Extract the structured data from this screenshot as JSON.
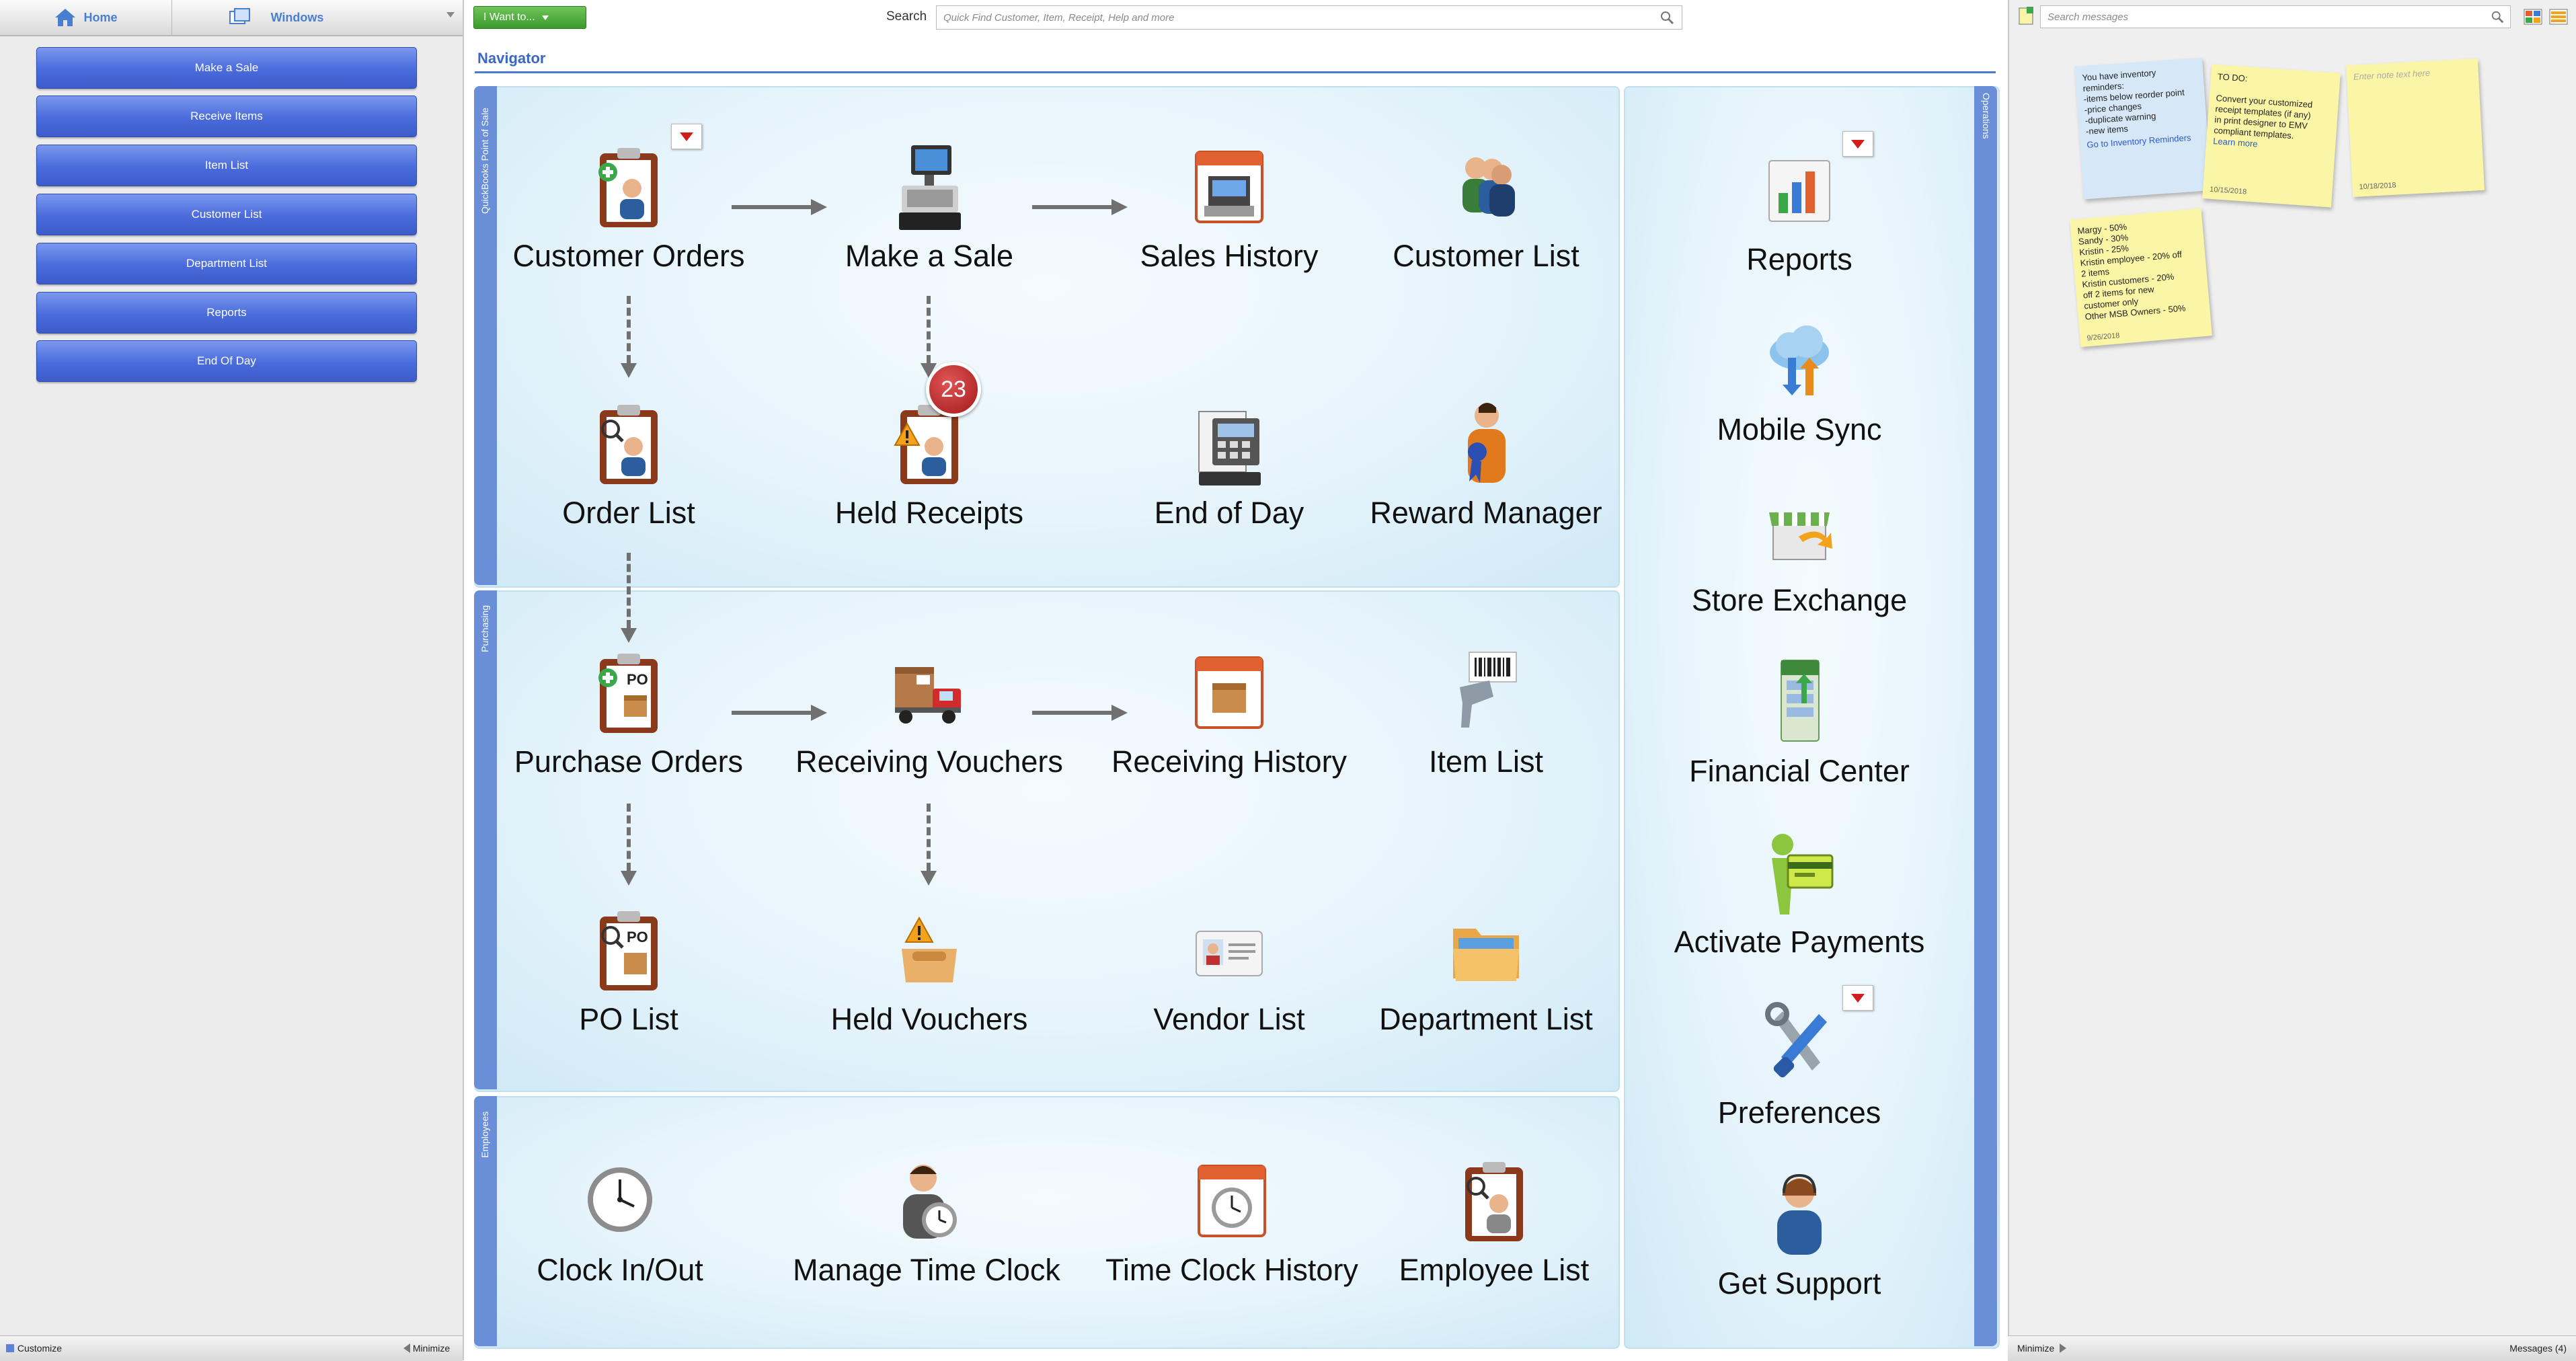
{
  "left": {
    "tabs": {
      "home": "Home",
      "windows": "Windows"
    },
    "shortcuts": [
      "Make a Sale",
      "Receive Items",
      "Item List",
      "Customer List",
      "Department List",
      "Reports",
      "End Of Day"
    ],
    "customize": "Customize",
    "minimize": "Minimize"
  },
  "topbar": {
    "i_want_to": "I Want to...",
    "search_label": "Search",
    "search_placeholder": "Quick Find Customer, Item, Receipt, Help and more"
  },
  "navigator": {
    "title": "Navigator",
    "sections": {
      "pos": "QuickBooks Point of Sale",
      "purchasing": "Purchasing",
      "employees": "Employees",
      "operations": "Operations"
    },
    "pos_items": [
      "Customer Orders",
      "Make a Sale",
      "Sales History",
      "Customer List",
      "Order List",
      "Held Receipts",
      "End of Day",
      "Reward Manager"
    ],
    "held_receipts_count": "23",
    "purchasing_items": [
      "Purchase Orders",
      "Receiving Vouchers",
      "Receiving History",
      "Item List",
      "PO List",
      "Held Vouchers",
      "Vendor List",
      "Department List"
    ],
    "employee_items": [
      "Clock In/Out",
      "Manage Time Clock",
      "Time Clock History",
      "Employee List"
    ],
    "operations_items": [
      "Reports",
      "Mobile Sync",
      "Store Exchange",
      "Financial Center",
      "Activate Payments",
      "Preferences",
      "Get Support"
    ]
  },
  "right": {
    "search_placeholder": "Search messages",
    "notes": {
      "reminder": {
        "lines": [
          "You have inventory",
          "reminders:",
          "-items below reorder point",
          "-price changes",
          "-duplicate warning",
          "-new items"
        ],
        "link": "Go to Inventory Reminders"
      },
      "todo": {
        "lines": [
          "TO DO:",
          "",
          "Convert your customized",
          "receipt templates (if any)",
          "in print designer to EMV",
          "compliant templates."
        ],
        "link": "Learn more",
        "date": "10/15/2018"
      },
      "empty": {
        "placeholder": "Enter note text here",
        "date": "10/18/2018"
      },
      "discounts": {
        "lines": [
          "Margy - 50%",
          "Sandy - 30%",
          "Kristin - 25%",
          "Kristin employee - 20% off",
          "2 items",
          "Kristin customers - 20%",
          "off 2 items for new",
          "customer only",
          "Other MSB Owners - 50%"
        ],
        "date": "9/26/2018"
      }
    },
    "minimize": "Minimize",
    "messages": "Messages (4)"
  }
}
